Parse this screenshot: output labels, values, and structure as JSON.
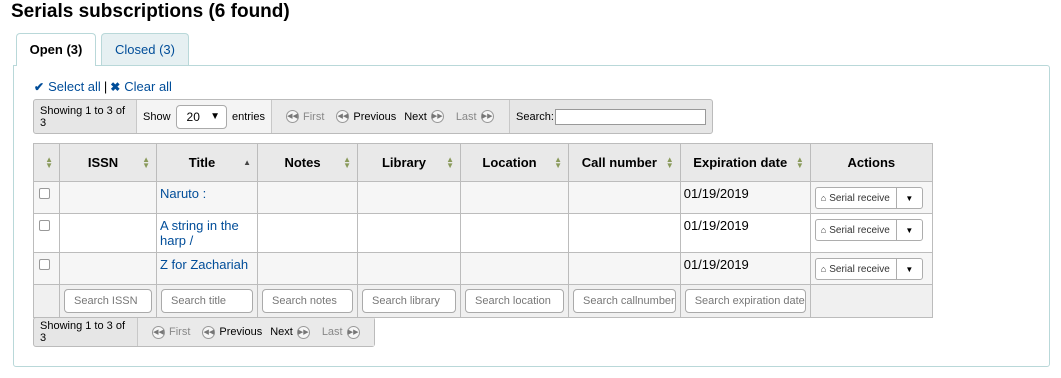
{
  "page": {
    "title": "Serials subscriptions (6 found)"
  },
  "tabs": [
    {
      "label": "Open (3)",
      "active": true
    },
    {
      "label": "Closed (3)",
      "active": false
    }
  ],
  "selection": {
    "select_all": "Select all",
    "separator": "|",
    "clear_all": "Clear all"
  },
  "toolbar_top": {
    "info": "Showing 1 to 3 of 3",
    "show_label": "Show",
    "length_value": "20",
    "entries_label": "entries",
    "first": "First",
    "previous": "Previous",
    "next": "Next",
    "last": "Last",
    "search_label": "Search:"
  },
  "toolbar_bottom": {
    "info": "Showing 1 to 3 of 3",
    "first": "First",
    "previous": "Previous",
    "next": "Next",
    "last": "Last"
  },
  "table": {
    "headers": [
      "ISSN",
      "Title",
      "Notes",
      "Library",
      "Location",
      "Call number",
      "Expiration date",
      "Actions"
    ],
    "rows": [
      {
        "issn": "",
        "title": "Naruto :",
        "notes": "",
        "library": "",
        "location": "",
        "callnumber": "",
        "expiration": "01/19/2019",
        "action": "Serial receive"
      },
      {
        "issn": "",
        "title": "A string in the harp /",
        "notes": "",
        "library": "",
        "location": "",
        "callnumber": "",
        "expiration": "01/19/2019",
        "action": "Serial receive"
      },
      {
        "issn": "",
        "title": "Z for Zachariah",
        "notes": "",
        "library": "",
        "location": "",
        "callnumber": "",
        "expiration": "01/19/2019",
        "action": "Serial receive"
      }
    ],
    "filters": [
      "Search ISSN",
      "Search title",
      "Search notes",
      "Search library",
      "Search location",
      "Search callnumber",
      "Search expiration date"
    ]
  },
  "icons": {
    "check": "check-icon",
    "x": "x-icon",
    "inbox": "inbox-icon",
    "caret": "caret-down-icon",
    "first": "first-page-icon",
    "prev": "prev-page-icon",
    "next": "next-page-icon",
    "last": "last-page-icon"
  },
  "colors": {
    "link": "#004d99",
    "tab_border": "#b9d8d9",
    "header_bg": "#e9e9e9"
  }
}
